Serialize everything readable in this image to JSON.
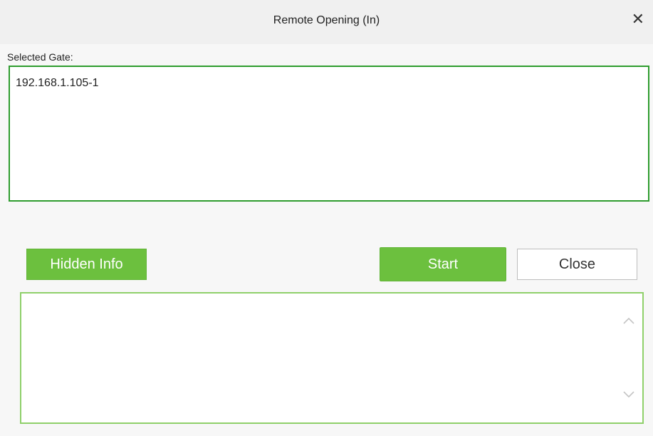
{
  "dialog": {
    "title": "Remote Opening (In)",
    "close_icon": "close-icon"
  },
  "gate": {
    "label": "Selected Gate:",
    "items": [
      "192.168.1.105-1"
    ]
  },
  "buttons": {
    "hidden_info": "Hidden Info",
    "start": "Start",
    "close": "Close"
  },
  "log": {
    "content": "",
    "scroll_up_icon": "chevron-up-icon",
    "scroll_down_icon": "chevron-down-icon"
  },
  "colors": {
    "accent_green": "#6cc03e",
    "border_green": "#2e9c2e",
    "light_border_green": "#8fd06a"
  }
}
